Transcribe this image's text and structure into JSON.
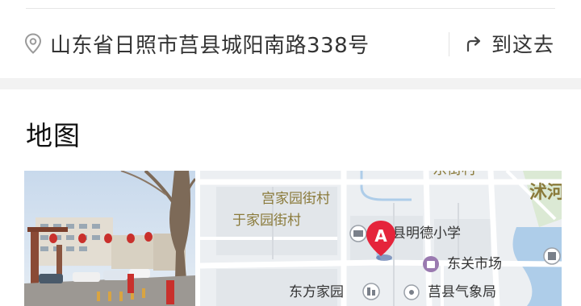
{
  "address": {
    "text": "山东省日照市莒县城阳南路338号",
    "icon": "location-pin-icon"
  },
  "directions": {
    "label": "到这去",
    "icon": "route-arrow-icon"
  },
  "map_section": {
    "title": "地图",
    "marker_label": "A",
    "marker_color": "#e5243b",
    "labels": {
      "gong_village": "宫家园街村",
      "yu_village": "于家园街村",
      "top_partial": "东街村",
      "mingde_school": "县明德小学",
      "dongguan_market": "东关市场",
      "dongfang_garden": "东方家园",
      "weather_bureau": "莒县气象局",
      "right_partial": "沭河"
    }
  }
}
